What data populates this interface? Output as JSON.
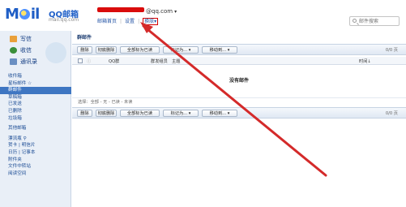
{
  "header": {
    "brand": "QQ邮箱",
    "brand_sub": "mail.qq.com",
    "email_suffix": "@qq.com",
    "email_caret": "▾",
    "links": {
      "home": "邮箱首页",
      "settings_sep_1": "|",
      "settings": "设置",
      "settings_sep_2": "|",
      "skin": "换肤▾"
    },
    "search_placeholder": "邮件搜索"
  },
  "sidebar": {
    "compose": "写信",
    "receive": "收信",
    "contacts": "通讯录",
    "folders": [
      {
        "label": "收件箱",
        "active": false
      },
      {
        "label": "星标邮件 ☆",
        "active": false
      },
      {
        "label": "群邮件",
        "active": true
      },
      {
        "label": "草稿箱",
        "active": false
      },
      {
        "label": "已发送",
        "active": false
      },
      {
        "label": "已删除",
        "active": false
      },
      {
        "label": "垃圾箱",
        "active": false
      }
    ],
    "other_mailbox": "其他邮箱",
    "apps": [
      "漂流瓶 ⚲",
      "贺卡 | 明信片",
      "日历 | 记事本",
      "附件夹",
      "文件中转站",
      "阅读空间"
    ]
  },
  "main": {
    "title": "群邮件",
    "toolbar_buttons": [
      "删除",
      "彻底删除",
      "全部标为已读",
      "标记为... ▾",
      "移动到... ▾"
    ],
    "pager": "0/0 页",
    "columns": {
      "checkbox_icon": "☐",
      "sender": "QQ群",
      "sender_icon": "ⓘ",
      "member": "群发组员",
      "subject": "主题",
      "time": "时间↓"
    },
    "empty_message": "没有邮件",
    "select_row": "选择：全部 - 无 - 已读 - 未读"
  },
  "annotation": {
    "arrow_color": "#d42a2a"
  }
}
